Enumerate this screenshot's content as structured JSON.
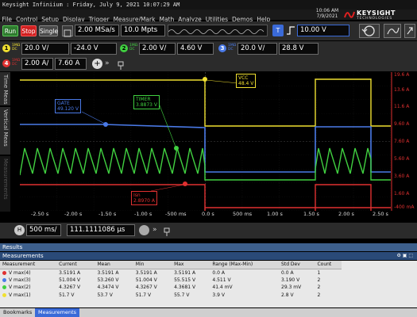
{
  "title_bar": "Keysight Infiniium : Friday, July 9, 2021 10:07:29 AM",
  "menu": [
    "File",
    "Control",
    "Setup",
    "Display",
    "Trigger",
    "Measure/Mark",
    "Math",
    "Analyze",
    "Utilities",
    "Demos",
    "Help"
  ],
  "clock": {
    "time": "10:06 AM",
    "date": "7/9/2021"
  },
  "brand": {
    "name": "KEYSIGHT",
    "sub": "TECHNOLOGIES"
  },
  "controls": {
    "run": "Run",
    "stop": "Stop",
    "single": "Single",
    "sample_rate": "2.00 MSa/s",
    "memory_depth": "10.0 Mpts",
    "trigger_level": "10.00 V",
    "trigger_channel": "T"
  },
  "channels": [
    {
      "num": "1",
      "coupling": "1MΩ DC",
      "scale": "20.0 V/",
      "offset": "-24.0 V",
      "color": "#f0e030"
    },
    {
      "num": "2",
      "coupling": "1MΩ DC",
      "scale": "2.00 V/",
      "offset": "4.60 V",
      "color": "#40d040"
    },
    {
      "num": "3",
      "coupling": "1MΩ DC",
      "scale": "20.0 V/",
      "offset": "28.8 V",
      "color": "#4a7ae8"
    },
    {
      "num": "4",
      "coupling": "1MΩ DC",
      "scale": "2.00 A/",
      "offset": "7.60 A",
      "color": "#e03030"
    }
  ],
  "side_tabs": [
    "Time Meas",
    "Vertical Meas",
    "Measurements"
  ],
  "markers": {
    "vcc": {
      "name": "VCC",
      "value": "48.4 V"
    },
    "gate": {
      "name": "GATE",
      "value": "49.120 V"
    },
    "timer": {
      "name": "TIMER",
      "value": "3.8873 V"
    },
    "isn": {
      "name": "Isn",
      "value": "2.8970 A"
    }
  },
  "right_axis": [
    "19.6 A",
    "13.6 A",
    "11.6 A",
    "9.60 A",
    "7.60 A",
    "5.60 A",
    "3.60 A",
    "1.60 A",
    "-400 mA"
  ],
  "x_axis": [
    "-2.50 s",
    "-2.00 s",
    "-1.50 s",
    "-1.00 s",
    "-500 ms",
    "0.0 s",
    "500 ms",
    "1.00 s",
    "1.50 s",
    "2.00 s",
    "2.50 s"
  ],
  "horizontal": {
    "scale": "500 ms/",
    "position": "111.1111086 µs"
  },
  "results_label": "Results",
  "measurements_label": "Measurements",
  "table": {
    "headers": [
      "Measurement",
      "Current",
      "Mean",
      "Min",
      "Max",
      "Range (Max-Min)",
      "Std Dev",
      "Count"
    ],
    "rows": [
      {
        "color": "#e03030",
        "cells": [
          "V max(4)",
          "3.5191 A",
          "3.5191 A",
          "3.5191 A",
          "3.5191 A",
          "0.0 A",
          "0.0 A",
          "1"
        ]
      },
      {
        "color": "#4a7ae8",
        "cells": [
          "V max(3)",
          "51.004 V",
          "53.260 V",
          "51.004 V",
          "55.515 V",
          "4.511 V",
          "3.190 V",
          "2"
        ]
      },
      {
        "color": "#40d040",
        "cells": [
          "V max(2)",
          "4.3267 V",
          "4.3474 V",
          "4.3267 V",
          "4.3681 V",
          "41.4 mV",
          "29.3 mV",
          "2"
        ]
      },
      {
        "color": "#f0e030",
        "cells": [
          "V max(1)",
          "51.7 V",
          "53.7 V",
          "51.7 V",
          "55.7 V",
          "3.9 V",
          "2.8 V",
          "2"
        ]
      }
    ]
  },
  "bottom_tabs": [
    "Bookmarks",
    "Measurements"
  ]
}
